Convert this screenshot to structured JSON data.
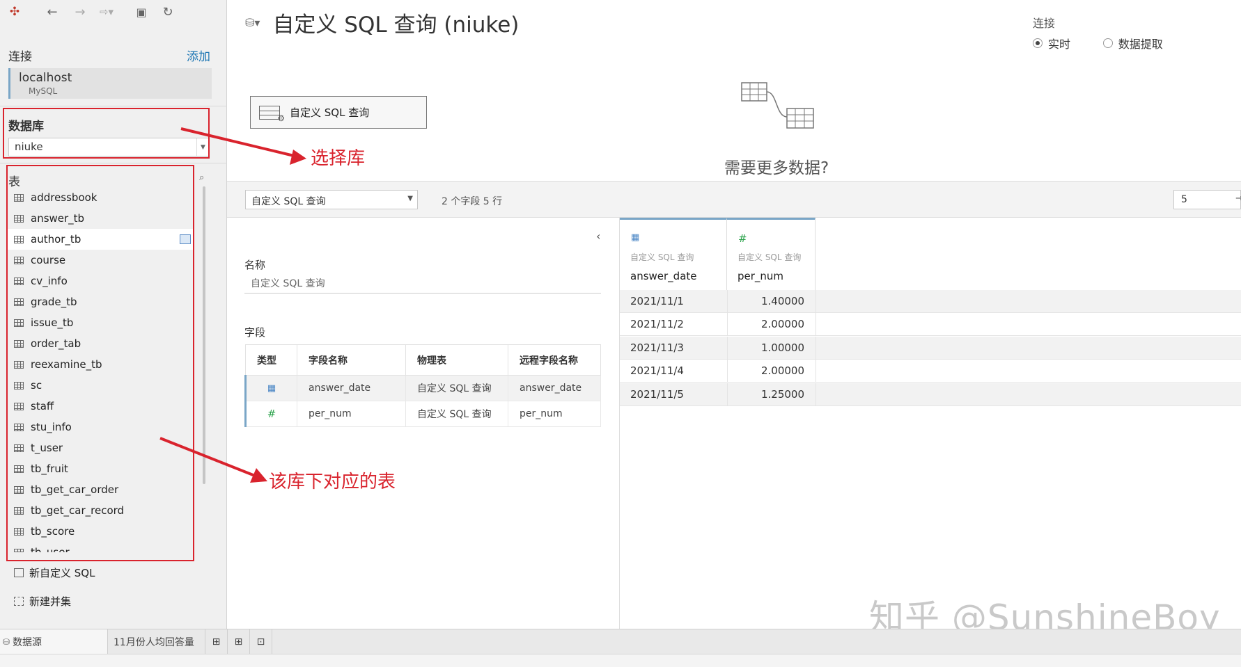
{
  "toolbar": {
    "icons": [
      "tableau-logo-icon",
      "back-icon",
      "forward-icon",
      "redo-icon",
      "save-icon",
      "refresh-icon"
    ]
  },
  "connections": {
    "label": "连接",
    "add_label": "添加",
    "host": "localhost",
    "type": "MySQL"
  },
  "database": {
    "label": "数据库",
    "selected": "niuke"
  },
  "tables": {
    "label": "表",
    "items": [
      "addressbook",
      "answer_tb",
      "author_tb",
      "course",
      "cv_info",
      "grade_tb",
      "issue_tb",
      "order_tab",
      "reexamine_tb",
      "sc",
      "staff",
      "stu_info",
      "t_user",
      "tb_fruit",
      "tb_get_car_order",
      "tb_get_car_record",
      "tb_score",
      "tb_user"
    ],
    "selected_index": 2,
    "new_custom_sql": "新自定义 SQL",
    "new_union": "新建并集"
  },
  "header": {
    "title": "自定义 SQL 查询 (niuke)",
    "connection_label": "连接",
    "mode_live": "实时",
    "mode_extract": "数据提取"
  },
  "canvas": {
    "table_label": "自定义 SQL 查询",
    "more_data": "需要更多数据?"
  },
  "grid_toolbar": {
    "table_picker": "自定义 SQL 查询",
    "field_count": "2 个字段 5 行",
    "rows": "5"
  },
  "metadata": {
    "name_label": "名称",
    "name_value": "自定义 SQL 查询",
    "fields_label": "字段",
    "headers": [
      "类型",
      "字段名称",
      "物理表",
      "远程字段名称"
    ],
    "rows": [
      {
        "type_icon": "calendar-icon",
        "field": "answer_date",
        "table": "自定义 SQL 查询",
        "remote": "answer_date"
      },
      {
        "type_icon": "number-icon",
        "field": "per_num",
        "table": "自定义 SQL 查询",
        "remote": "per_num"
      }
    ]
  },
  "grid": {
    "columns": [
      {
        "icon": "calendar-icon",
        "source": "自定义 SQL 查询",
        "name": "answer_date"
      },
      {
        "icon": "number-icon",
        "source": "自定义 SQL 查询",
        "name": "per_num"
      }
    ],
    "rows": [
      [
        "2021/11/1",
        "1.40000"
      ],
      [
        "2021/11/2",
        "2.00000"
      ],
      [
        "2021/11/3",
        "1.00000"
      ],
      [
        "2021/11/4",
        "2.00000"
      ],
      [
        "2021/11/5",
        "1.25000"
      ]
    ]
  },
  "annotations": {
    "select_db": "选择库",
    "tables_in_db": "该库下对应的表",
    "accent_color": "#d9232d"
  },
  "watermark": "知乎 @SunshineBoy",
  "tabs": {
    "datasource": "数据源",
    "sheet": "11月份人均回答量"
  }
}
